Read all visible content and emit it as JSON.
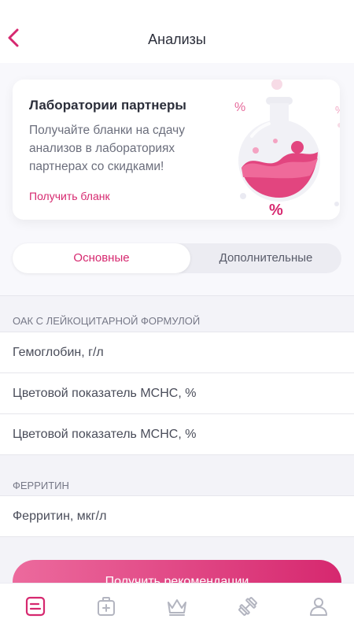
{
  "header": {
    "title": "Анализы"
  },
  "promo": {
    "title": "Лаборатории партнеры",
    "text": "Получайте бланки на сдачу анализов в лабораториях партнерах со скидками!",
    "link": "Получить бланк",
    "percent_sign": "%"
  },
  "segments": {
    "main": "Основные",
    "extra": "Дополнительные",
    "active": "main"
  },
  "sections": [
    {
      "title": "ОАК С ЛЕЙКОЦИТАРНОЙ ФОРМУЛОЙ",
      "items": [
        "Гемоглобин, г/л",
        "Цветовой показатель MCHC, %",
        "Цветовой показатель MCHC, %"
      ]
    },
    {
      "title": "ФЕРРИТИН",
      "items": [
        "Ферритин, мкг/л"
      ]
    }
  ],
  "cta": {
    "label": "Получить рекомендации"
  },
  "tabbar": {
    "items": [
      "analyses-icon",
      "medkit-icon",
      "crown-icon",
      "dumbbell-icon",
      "profile-icon"
    ],
    "active": "analyses-icon"
  },
  "colors": {
    "accent": "#d6286f",
    "accent_light": "#ec6a9d",
    "text": "#2b2e3a",
    "muted": "#6b6e7c",
    "inactive_icon": "#b3b5c0"
  }
}
